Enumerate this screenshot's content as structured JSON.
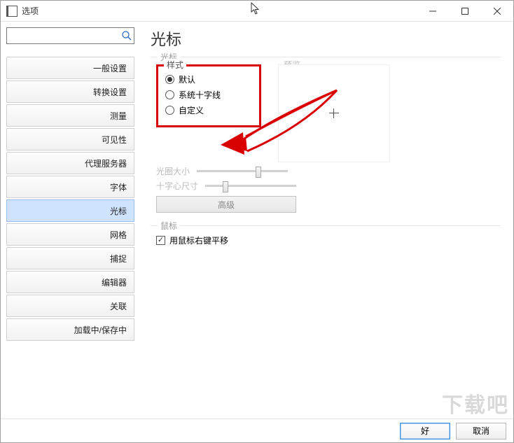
{
  "window": {
    "title": "选项"
  },
  "search": {
    "placeholder": ""
  },
  "sidebar": {
    "items": [
      {
        "label": "一般设置"
      },
      {
        "label": "转换设置"
      },
      {
        "label": "测量"
      },
      {
        "label": "可见性"
      },
      {
        "label": "代理服务器"
      },
      {
        "label": "字体"
      },
      {
        "label": "光标"
      },
      {
        "label": "网格"
      },
      {
        "label": "捕捉"
      },
      {
        "label": "编辑器"
      },
      {
        "label": "关联"
      },
      {
        "label": "加载中/保存中"
      }
    ],
    "active_index": 6
  },
  "main": {
    "page_title": "光标",
    "cursor_group": {
      "label": "光标",
      "style": {
        "legend": "样式",
        "default": "默认",
        "system_cross": "系统十字线",
        "custom": "自定义",
        "selected": "default"
      },
      "preview_label": "预览",
      "aperture_label": "光圈大小",
      "aperture_pos": 0.68,
      "crosshair_label": "十字心尺寸",
      "crosshair_pos": 0.2,
      "advanced_label": "高级"
    },
    "mouse_group": {
      "label": "鼠标",
      "pan_checkbox_label": "用鼠标右键平移",
      "pan_checked": true
    }
  },
  "footer": {
    "ok": "好",
    "cancel": "取消"
  },
  "watermark": "下载吧"
}
